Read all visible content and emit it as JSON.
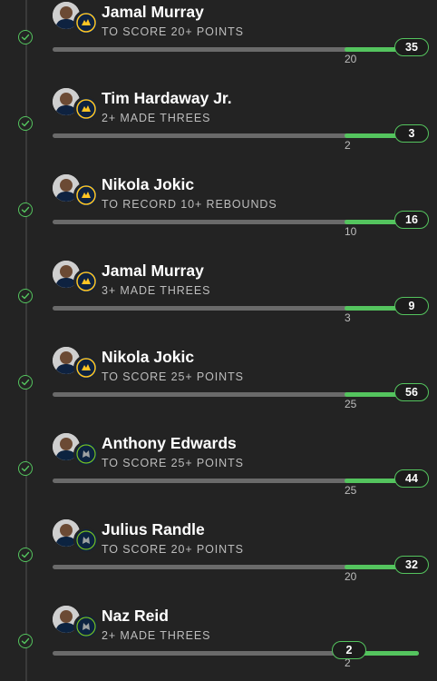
{
  "colors": {
    "background": "#232323",
    "accent": "#54c45e",
    "track": "#6a6a6a",
    "text_primary": "#ffffff",
    "text_secondary": "#bdbdbd"
  },
  "legs": [
    {
      "player": "Jamal Murray",
      "prop": "TO SCORE 20+ POINTS",
      "threshold": "20",
      "actual": "35",
      "team": "denver-nuggets",
      "status": "hit"
    },
    {
      "player": "Tim Hardaway Jr.",
      "prop": "2+ MADE THREES",
      "threshold": "2",
      "actual": "3",
      "team": "denver-nuggets",
      "status": "hit"
    },
    {
      "player": "Nikola Jokic",
      "prop": "TO RECORD 10+ REBOUNDS",
      "threshold": "10",
      "actual": "16",
      "team": "denver-nuggets",
      "status": "hit"
    },
    {
      "player": "Jamal Murray",
      "prop": "3+ MADE THREES",
      "threshold": "3",
      "actual": "9",
      "team": "denver-nuggets",
      "status": "hit"
    },
    {
      "player": "Nikola Jokic",
      "prop": "TO SCORE 25+ POINTS",
      "threshold": "25",
      "actual": "56",
      "team": "denver-nuggets",
      "status": "hit"
    },
    {
      "player": "Anthony Edwards",
      "prop": "TO SCORE 25+ POINTS",
      "threshold": "25",
      "actual": "44",
      "team": "minnesota-timberwolves",
      "status": "hit"
    },
    {
      "player": "Julius Randle",
      "prop": "TO SCORE 20+ POINTS",
      "threshold": "20",
      "actual": "32",
      "team": "minnesota-timberwolves",
      "status": "hit"
    },
    {
      "player": "Naz Reid",
      "prop": "2+ MADE THREES",
      "threshold": "2",
      "actual": "2",
      "team": "minnesota-timberwolves",
      "status": "hit"
    }
  ]
}
